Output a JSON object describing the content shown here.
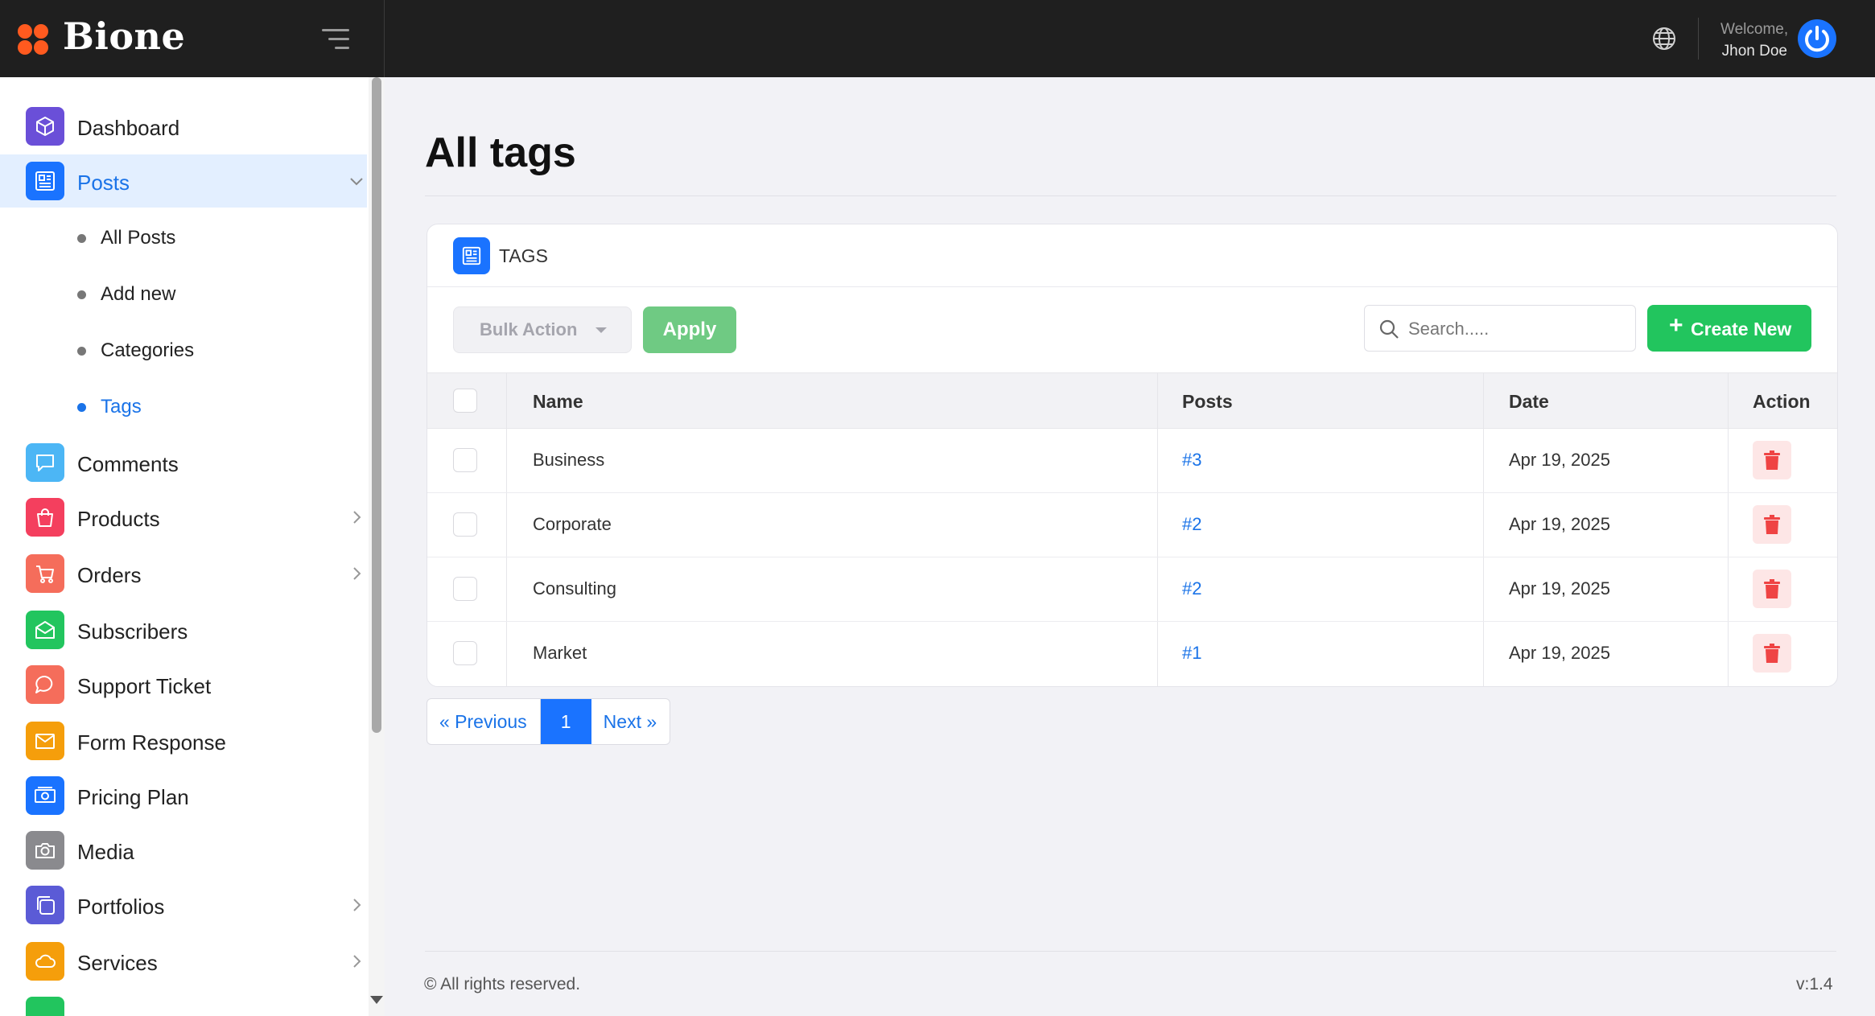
{
  "brand": {
    "name": "Bione"
  },
  "header": {
    "welcome": "Welcome,",
    "user_name": "Jhon Doe"
  },
  "sidebar": {
    "items": [
      {
        "label": "Dashboard",
        "icon": "cube-icon",
        "color": "#6a4fd8"
      },
      {
        "label": "Posts",
        "icon": "newspaper-icon",
        "color": "#1a73ff"
      },
      {
        "label": "Comments",
        "icon": "comment-icon",
        "color": "#4cb6f5"
      },
      {
        "label": "Products",
        "icon": "bag-icon",
        "color": "#f43f5e"
      },
      {
        "label": "Orders",
        "icon": "cart-icon",
        "color": "#f56d5b"
      },
      {
        "label": "Subscribers",
        "icon": "mail-open-icon",
        "color": "#22c55e"
      },
      {
        "label": "Support Ticket",
        "icon": "chat-icon",
        "color": "#f56d5b"
      },
      {
        "label": "Form Response",
        "icon": "envelope-icon",
        "color": "#f59e0b"
      },
      {
        "label": "Pricing Plan",
        "icon": "money-icon",
        "color": "#1a73ff"
      },
      {
        "label": "Media",
        "icon": "camera-icon",
        "color": "#8a8a8e"
      },
      {
        "label": "Portfolios",
        "icon": "copy-icon",
        "color": "#5b5bd6"
      },
      {
        "label": "Services",
        "icon": "cloud-icon",
        "color": "#f59e0b"
      }
    ],
    "posts_submenu": [
      "All Posts",
      "Add new",
      "Categories",
      "Tags"
    ]
  },
  "main": {
    "title": "All tags",
    "card_title": "TAGS",
    "bulk_action": "Bulk Action",
    "apply_label": "Apply",
    "search_placeholder": "Search.....",
    "create_label": "Create New",
    "columns": {
      "name": "Name",
      "posts": "Posts",
      "date": "Date",
      "action": "Action"
    },
    "rows": [
      {
        "name": "Business",
        "posts": "#3",
        "date": "Apr 19, 2025"
      },
      {
        "name": "Corporate",
        "posts": "#2",
        "date": "Apr 19, 2025"
      },
      {
        "name": "Consulting",
        "posts": "#2",
        "date": "Apr 19, 2025"
      },
      {
        "name": "Market",
        "posts": "#1",
        "date": "Apr 19, 2025"
      }
    ],
    "pagination": {
      "previous": "« Previous",
      "current": "1",
      "next": "Next »"
    }
  },
  "footer": {
    "copyright": "© All rights reserved.",
    "version": "v:1.4"
  },
  "colors": {
    "topbar": "#1f1f1f",
    "accent": "#1a73ff",
    "success": "#22c55e",
    "danger": "#ef4444",
    "logo": "#ff5a1f"
  }
}
